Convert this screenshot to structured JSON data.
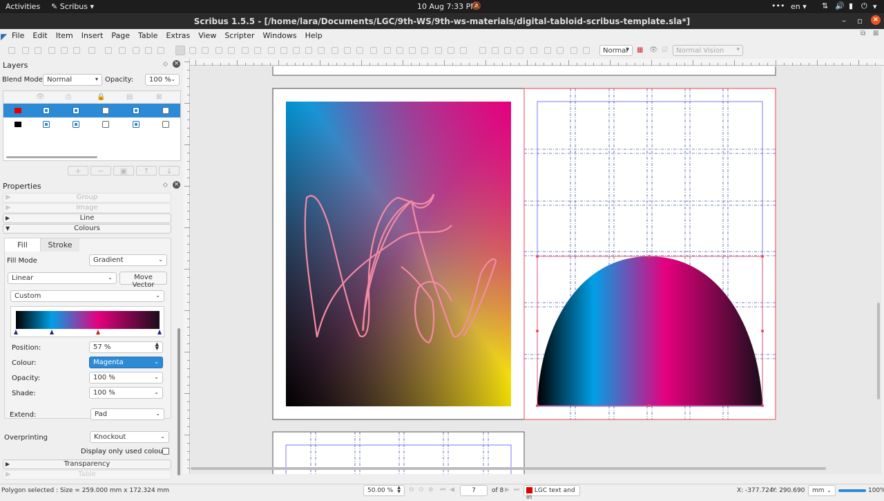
{
  "topbar": {
    "activities": "Activities",
    "app": "Scribus",
    "datetime": "10 Aug  7:33 PM",
    "lang": "en"
  },
  "titlebar": {
    "title": "Scribus 1.5.5 - [/home/lara/Documents/LGC/9th-WS/9th-ws-materials/digital-tabloid-scribus-template.sla*]"
  },
  "menu": [
    "File",
    "Edit",
    "Item",
    "Insert",
    "Page",
    "Table",
    "Extras",
    "View",
    "Scripter",
    "Windows",
    "Help"
  ],
  "toolbar": {
    "preview_mode": "Normal",
    "vision": "Normal Vision"
  },
  "layers": {
    "title": "Layers",
    "blend_label": "Blend Mode:",
    "blend_value": "Normal",
    "opacity_label": "Opacity:",
    "opacity_value": "100 %",
    "rows": [
      {
        "color": "#e00000",
        "visible": true,
        "print": true,
        "locked": false,
        "flow": true,
        "outline": false,
        "selected": true
      },
      {
        "color": "#000000",
        "visible": true,
        "print": true,
        "locked": false,
        "flow": true,
        "outline": false,
        "selected": false
      }
    ]
  },
  "properties": {
    "title": "Properties",
    "sections": {
      "group": "Group",
      "image": "Image",
      "line": "Line",
      "colours": "Colours",
      "transparency": "Transparency",
      "table": "Table"
    },
    "tabs": {
      "fill": "Fill",
      "stroke": "Stroke"
    },
    "fill_mode_label": "Fill Mode",
    "fill_mode_value": "Gradient",
    "gradient_type": "Linear",
    "move_vector": "Move Vector",
    "gradient_preset": "Custom",
    "gradient_stops": [
      {
        "pos": 0,
        "color": "#000000"
      },
      {
        "pos": 0.25,
        "color": "#00a0e6"
      },
      {
        "pos": 0.57,
        "color": "#e6007e"
      },
      {
        "pos": 1,
        "color": "#1a0d1a"
      }
    ],
    "position_label": "Position:",
    "position_value": "57 %",
    "colour_label": "Colour:",
    "colour_value": "Magenta",
    "opacity_label": "Opacity:",
    "opacity_value": "100 %",
    "shade_label": "Shade:",
    "shade_value": "100 %",
    "extend_label": "Extend:",
    "extend_value": "Pad",
    "overprinting_label": "Overprinting",
    "overprinting_value": "Knockout",
    "display_used": "Display only used colours"
  },
  "statusbar": {
    "selection": "Polygon selected : Size = 259.000 mm x 172.324 mm",
    "zoom": "50.00 %",
    "page": "7",
    "page_of": "of 8",
    "layer": "LGC text and in",
    "x": "X: -377.724",
    "y": "Y: 290.690",
    "unit": "mm",
    "zoom_pct": "100%"
  },
  "colors": {
    "accent": "#2d8bd6",
    "selection": "#e00000"
  }
}
